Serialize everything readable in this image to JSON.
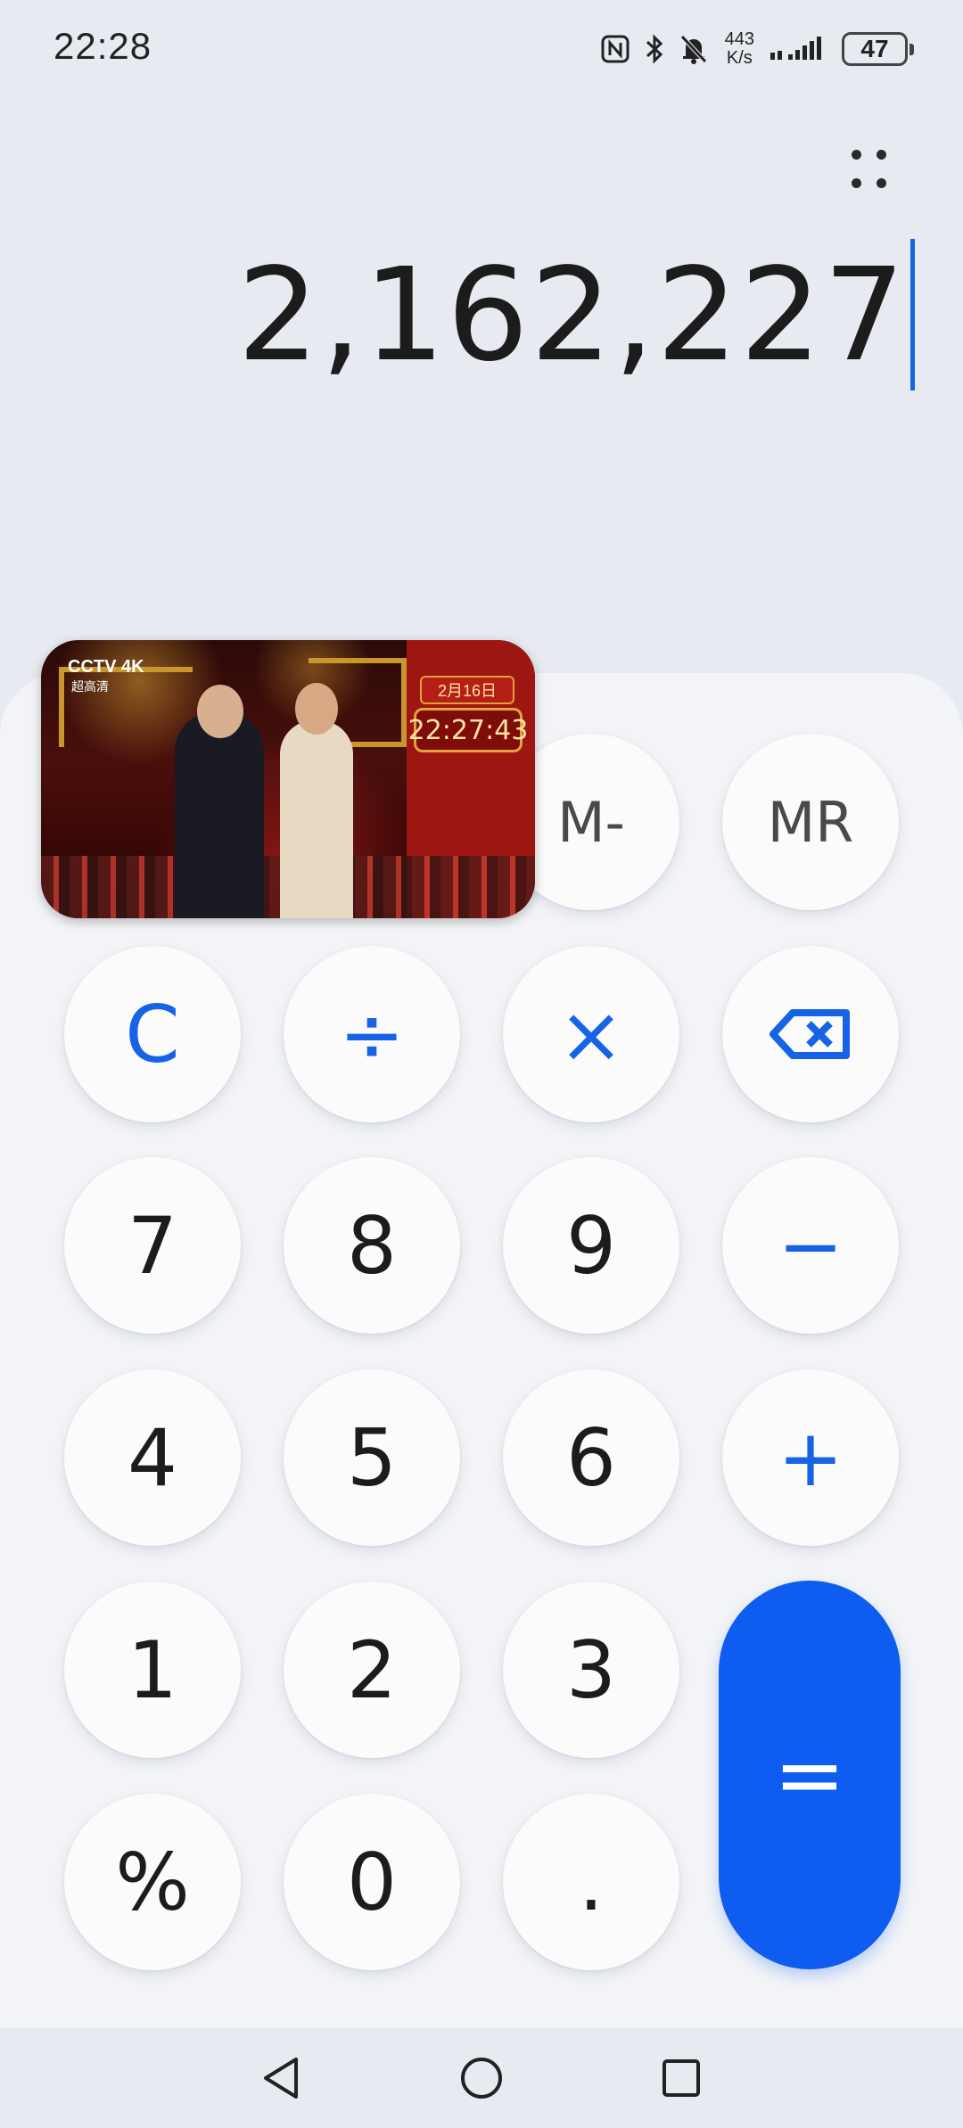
{
  "status_bar": {
    "time": "22:28",
    "net_speed_value": "443",
    "net_speed_unit": "K/s",
    "battery_level": "47",
    "icons": [
      "nfc-icon",
      "bluetooth-icon",
      "bell-muted-icon",
      "signal-icon",
      "battery-icon"
    ]
  },
  "menu": {
    "more_icon": "more-dots-icon"
  },
  "display": {
    "value": "2,162,227"
  },
  "pip": {
    "channel_logo": "CCTV 4K",
    "channel_sub": "超高清",
    "date": "2月16日",
    "time": "22:27:43"
  },
  "keys": {
    "m_minus": "M-",
    "mr": "MR",
    "clear": "C",
    "divide": "÷",
    "multiply": "×",
    "backspace_icon": "backspace-icon",
    "k7": "7",
    "k8": "8",
    "k9": "9",
    "minus": "−",
    "k4": "4",
    "k5": "5",
    "k6": "6",
    "plus": "+",
    "k1": "1",
    "k2": "2",
    "k3": "3",
    "equals": "=",
    "percent": "%",
    "k0": "0",
    "dot": "."
  },
  "colors": {
    "accent": "#1663e6",
    "equals_bg": "#0f5cf0",
    "background": "#e7ebf1",
    "keypad_bg": "#f2f4f7",
    "key_bg": "#fbfbfc"
  },
  "navbar": {
    "icons": [
      "back-icon",
      "home-icon",
      "recents-icon"
    ]
  }
}
